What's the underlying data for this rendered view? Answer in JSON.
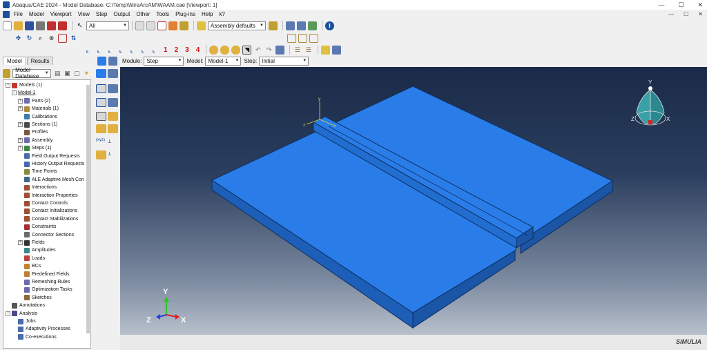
{
  "window": {
    "title": "Abaqus/CAE 2024 - Model Database: C:\\Temp\\WireArcAM\\WAAM.cae [Viewport: 1]",
    "min_glyph": "—",
    "max_glyph": "☐",
    "close_glyph": "✕"
  },
  "menu": [
    "File",
    "Model",
    "Viewport",
    "View",
    "Step",
    "Output",
    "Other",
    "Tools",
    "Plug-ins",
    "Help",
    "k?"
  ],
  "toolbar": {
    "selection_filter": "All",
    "render_style": "Assembly defaults",
    "view_numbers": [
      "1",
      "2",
      "3",
      "4"
    ]
  },
  "tabs": [
    "Model",
    "Results"
  ],
  "model_db_combo": "Model Database",
  "context": {
    "module_label": "Module:",
    "module_value": "Step",
    "model_label": "Model:",
    "model_value": "Model-1",
    "step_label": "Step:",
    "step_value": "Initial"
  },
  "tree": [
    {
      "label": "Models (1)",
      "indent": 0,
      "exp": "−",
      "color": "#c7352b"
    },
    {
      "label": "Model-1",
      "indent": 1,
      "exp": "−",
      "color": null,
      "underline": true
    },
    {
      "label": "Parts (2)",
      "indent": 2,
      "exp": "+",
      "color": "#6b6bb0"
    },
    {
      "label": "Materials (1)",
      "indent": 2,
      "exp": "+",
      "color": "#b08a3a"
    },
    {
      "label": "Calibrations",
      "indent": 2,
      "exp": "",
      "color": "#3a7bb0"
    },
    {
      "label": "Sections (1)",
      "indent": 2,
      "exp": "+",
      "color": "#4b4b4b"
    },
    {
      "label": "Profiles",
      "indent": 2,
      "exp": "",
      "color": "#7a5a3a"
    },
    {
      "label": "Assembly",
      "indent": 2,
      "exp": "+",
      "color": "#6b6bb0"
    },
    {
      "label": "Steps (1)",
      "indent": 2,
      "exp": "+",
      "color": "#3a8a3a"
    },
    {
      "label": "Field Output Requests",
      "indent": 2,
      "exp": "",
      "color": "#4a6ab0"
    },
    {
      "label": "History Output Requests",
      "indent": 2,
      "exp": "",
      "color": "#4a6ab0"
    },
    {
      "label": "Time Points",
      "indent": 2,
      "exp": "",
      "color": "#8a8a3a"
    },
    {
      "label": "ALE Adaptive Mesh Con",
      "indent": 2,
      "exp": "",
      "color": "#3a6a8a"
    },
    {
      "label": "Interactions",
      "indent": 2,
      "exp": "",
      "color": "#a05030"
    },
    {
      "label": "Interaction Properties",
      "indent": 2,
      "exp": "",
      "color": "#a05030"
    },
    {
      "label": "Contact Controls",
      "indent": 2,
      "exp": "",
      "color": "#a05030"
    },
    {
      "label": "Contact Initializations",
      "indent": 2,
      "exp": "",
      "color": "#a05030"
    },
    {
      "label": "Contact Stabilizations",
      "indent": 2,
      "exp": "",
      "color": "#a05030"
    },
    {
      "label": "Constraints",
      "indent": 2,
      "exp": "",
      "color": "#a03030"
    },
    {
      "label": "Connector Sections",
      "indent": 2,
      "exp": "",
      "color": "#6a6a6a"
    },
    {
      "label": "Fields",
      "indent": 2,
      "exp": "+",
      "color": "#333333"
    },
    {
      "label": "Amplitudes",
      "indent": 2,
      "exp": "",
      "color": "#3a8a8a"
    },
    {
      "label": "Loads",
      "indent": 2,
      "exp": "",
      "color": "#c04040"
    },
    {
      "label": "BCs",
      "indent": 2,
      "exp": "",
      "color": "#c08030"
    },
    {
      "label": "Predefined Fields",
      "indent": 2,
      "exp": "",
      "color": "#c08030"
    },
    {
      "label": "Remeshing Rules",
      "indent": 2,
      "exp": "",
      "color": "#6a6ab0"
    },
    {
      "label": "Optimization Tasks",
      "indent": 2,
      "exp": "",
      "color": "#6a6ab0"
    },
    {
      "label": "Sketches",
      "indent": 2,
      "exp": "",
      "color": "#8a6a3a"
    },
    {
      "label": "Annotations",
      "indent": 0,
      "exp": "",
      "color": "#555555"
    },
    {
      "label": "Analysis",
      "indent": 0,
      "exp": "−",
      "color": "#4a4a8a"
    },
    {
      "label": "Jobs",
      "indent": 1,
      "exp": "",
      "color": "#4a6ab0"
    },
    {
      "label": "Adaptivity Processes",
      "indent": 1,
      "exp": "",
      "color": "#4a6ab0"
    },
    {
      "label": "Co-executions",
      "indent": 1,
      "exp": "",
      "color": "#4a6ab0"
    }
  ],
  "triad": {
    "x": "X",
    "y": "Y",
    "z": "Z"
  },
  "compass": {
    "x": "X",
    "y": "Y",
    "z": "Z"
  },
  "local_csys": {
    "x": "x",
    "y": "y",
    "z": "z"
  },
  "brand": "SIMULIA",
  "colors": {
    "part_top": "#2a7de8",
    "part_side_front": "#1d5fb8",
    "part_side_right": "#1a55a6",
    "viewport_bg_top": "#1a2a48",
    "viewport_bg_bottom": "#b8c0cc"
  }
}
